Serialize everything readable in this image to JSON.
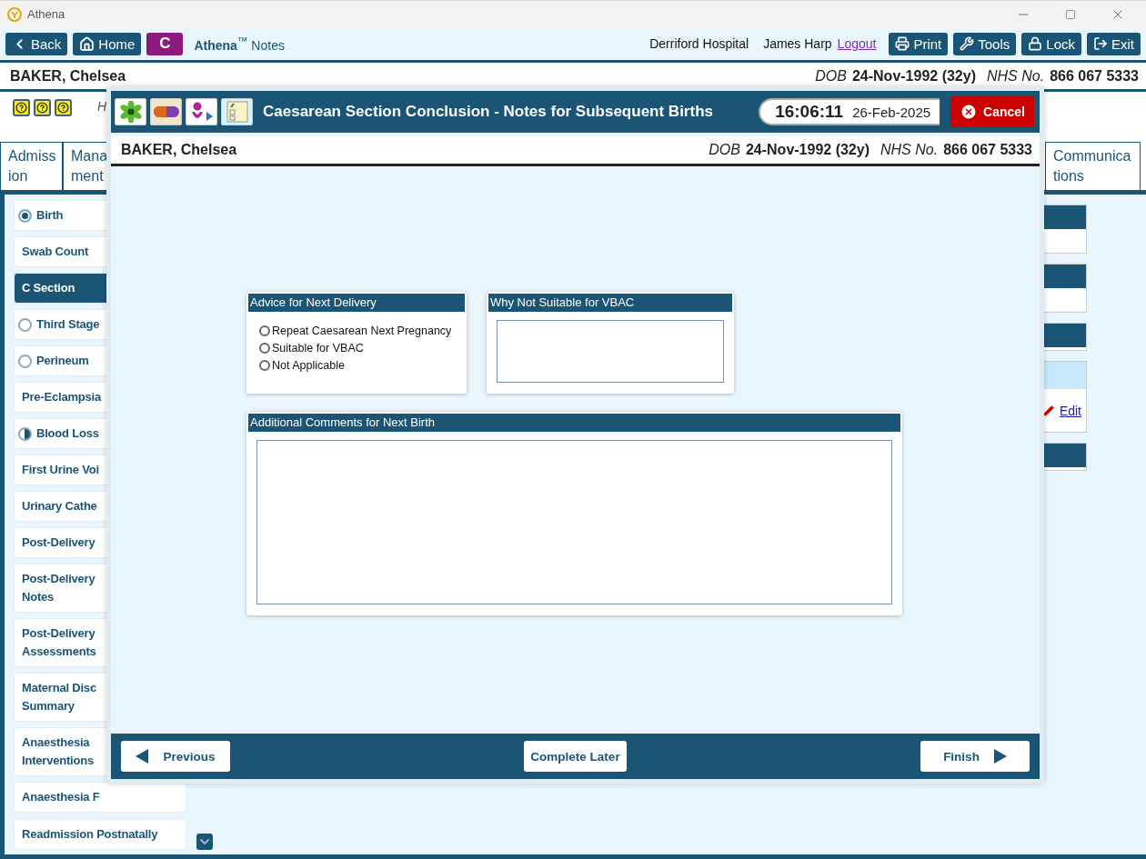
{
  "window": {
    "title": "Athena"
  },
  "toolbar": {
    "left_buttons": [
      {
        "label": "Back",
        "kind": "back"
      },
      {
        "label": "Home",
        "kind": "home"
      }
    ],
    "app_badge": "C",
    "app_name": "**Athena**$^{™}$ Notes",
    "site": "Derriford Hospital",
    "user": "James Harp",
    "logout": "Logout",
    "right_buttons": [
      {
        "label": "Print",
        "kind": "print"
      },
      {
        "label": "Tools",
        "kind": "tools"
      },
      {
        "label": "Lock",
        "kind": "lock"
      },
      {
        "label": "Exit",
        "kind": "exit"
      }
    ]
  },
  "patient": {
    "name": "BAKER, Chelsea",
    "dob_label": "DOB",
    "dob": "24-Nov-1992 (32y)",
    "nhs_label": "NHS No.",
    "nhs": "866 067 5333"
  },
  "help_text": "H",
  "tabs": [
    {
      "lines": [
        "Admiss",
        "ion"
      ],
      "selected": false
    },
    {
      "lines": [
        "Mana",
        "ment"
      ],
      "selected": false
    },
    {
      "lines": [
        "Communica",
        "tions"
      ],
      "selected": false
    }
  ],
  "sidebar": {
    "items": [
      {
        "lines": [
          "Birth"
        ],
        "kind": "complete",
        "selected": false
      },
      {
        "lines": [
          "Swab Count"
        ],
        "kind": "plain",
        "selected": false
      },
      {
        "lines": [
          "C Section"
        ],
        "kind": "plain",
        "selected": true
      },
      {
        "lines": [
          "Third Stage"
        ],
        "kind": "empty",
        "selected": false
      },
      {
        "lines": [
          "Perineum"
        ],
        "kind": "empty",
        "selected": false
      },
      {
        "lines": [
          "Pre-Eclampsia"
        ],
        "kind": "plain",
        "selected": false
      },
      {
        "lines": [
          "Blood Loss"
        ],
        "kind": "partial",
        "selected": false
      },
      {
        "lines": [
          "First Urine Voi"
        ],
        "kind": "plain",
        "selected": false
      },
      {
        "lines": [
          "Urinary Cathe"
        ],
        "kind": "plain",
        "selected": false
      },
      {
        "lines": [
          "Post-Delivery"
        ],
        "kind": "plain",
        "selected": false
      },
      {
        "lines": [
          "Post-Delivery",
          "Notes"
        ],
        "kind": "plain",
        "selected": false
      },
      {
        "lines": [
          "Post-Delivery",
          "Assessments"
        ],
        "kind": "plain",
        "selected": false
      },
      {
        "lines": [
          "Maternal Disc",
          "Summary"
        ],
        "kind": "plain",
        "selected": false
      },
      {
        "lines": [
          "Anaesthesia",
          "Interventions"
        ],
        "kind": "plain",
        "selected": false
      },
      {
        "lines": [
          "Anaesthesia F"
        ],
        "kind": "plain",
        "selected": false
      },
      {
        "lines": [
          "Readmission Postnatally"
        ],
        "kind": "plain",
        "selected": false
      }
    ]
  },
  "right_panels": [
    {
      "kind": "dark"
    },
    {
      "kind": "dark"
    },
    {
      "kind": "short"
    },
    {
      "kind": "edit",
      "link": "Edit"
    },
    {
      "kind": "short"
    }
  ],
  "dialog": {
    "title": "Caesarean Section Conclusion - Notes for Subsequent Births",
    "time": "16:06:11",
    "date": "26-Feb-2025",
    "cancel": "Cancel",
    "patient": {
      "name": "BAKER, Chelsea",
      "dob_label": "DOB",
      "dob": "24-Nov-1992 (32y)",
      "nhs_label": "NHS No.",
      "nhs": "866 067 5333"
    },
    "advice": {
      "title": "Advice for Next Delivery",
      "options": [
        {
          "label": "Repeat Caesarean Next Pregnancy",
          "selected": false
        },
        {
          "label": "Suitable for VBAC",
          "selected": false
        },
        {
          "label": "Not Applicable",
          "selected": false
        }
      ]
    },
    "why_not": {
      "title": "Why Not Suitable for VBAC"
    },
    "comments": {
      "title": "Additional Comments for Next Birth"
    },
    "footer": {
      "previous": "Previous",
      "later": "Complete Later",
      "finish": "Finish"
    }
  }
}
